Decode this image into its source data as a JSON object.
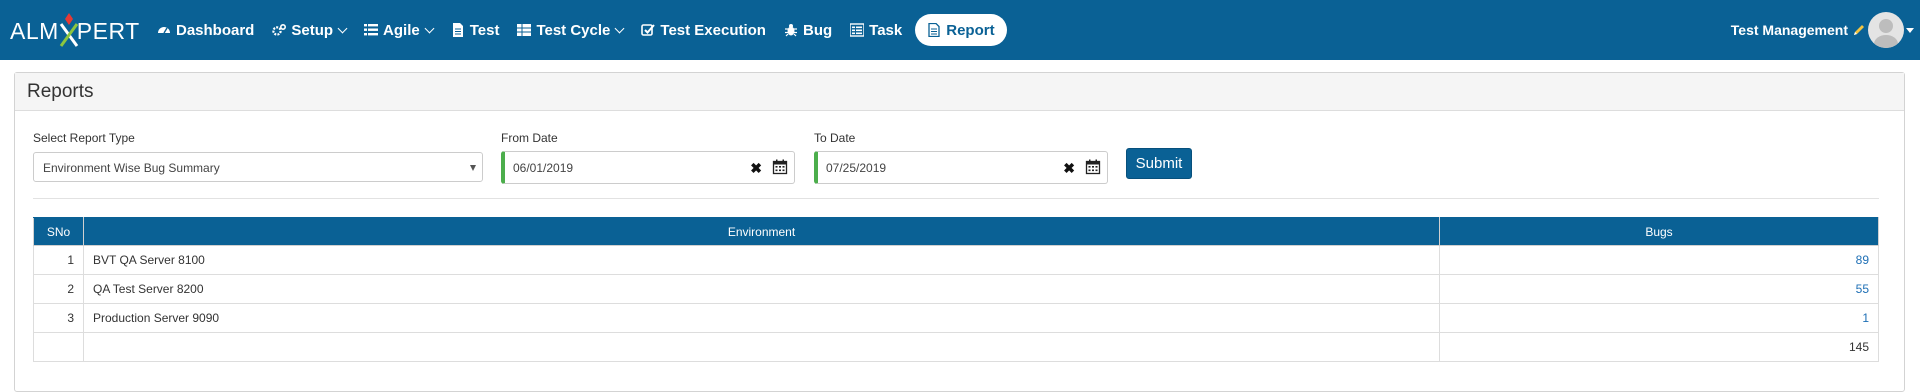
{
  "brand": {
    "prefix": "ALM",
    "suffix": "PERT"
  },
  "nav": {
    "items": [
      {
        "label": "Dashboard",
        "icon": "dashboard-icon",
        "caret": false
      },
      {
        "label": "Setup",
        "icon": "gears-icon",
        "caret": true
      },
      {
        "label": "Agile",
        "icon": "list-icon",
        "caret": true
      },
      {
        "label": "Test",
        "icon": "document-icon",
        "caret": false
      },
      {
        "label": "Test Cycle",
        "icon": "table-icon",
        "caret": true
      },
      {
        "label": "Test Execution",
        "icon": "checkbox-icon",
        "caret": false
      },
      {
        "label": "Bug",
        "icon": "bug-icon",
        "caret": false
      },
      {
        "label": "Task",
        "icon": "tasks-icon",
        "caret": false
      },
      {
        "label": "Report",
        "icon": "report-icon",
        "caret": false,
        "active": true
      }
    ]
  },
  "user": {
    "name": "Test Management"
  },
  "panel": {
    "title": "Reports"
  },
  "filters": {
    "report_type_label": "Select Report Type",
    "report_type_value": "Environment Wise Bug Summary",
    "from_label": "From Date",
    "from_value": "06/01/2019",
    "to_label": "To Date",
    "to_value": "07/25/2019",
    "submit_label": "Submit"
  },
  "table": {
    "headers": [
      "SNo",
      "Environment",
      "Bugs"
    ],
    "rows": [
      {
        "sno": "1",
        "environment": "BVT QA Server 8100",
        "bugs": "89"
      },
      {
        "sno": "2",
        "environment": "QA Test Server 8200",
        "bugs": "55"
      },
      {
        "sno": "3",
        "environment": "Production Server 9090",
        "bugs": "1"
      }
    ],
    "total": "145"
  },
  "colors": {
    "primary": "#0a6195",
    "date_accent": "#4cae4c",
    "link": "#1e6fb5"
  }
}
